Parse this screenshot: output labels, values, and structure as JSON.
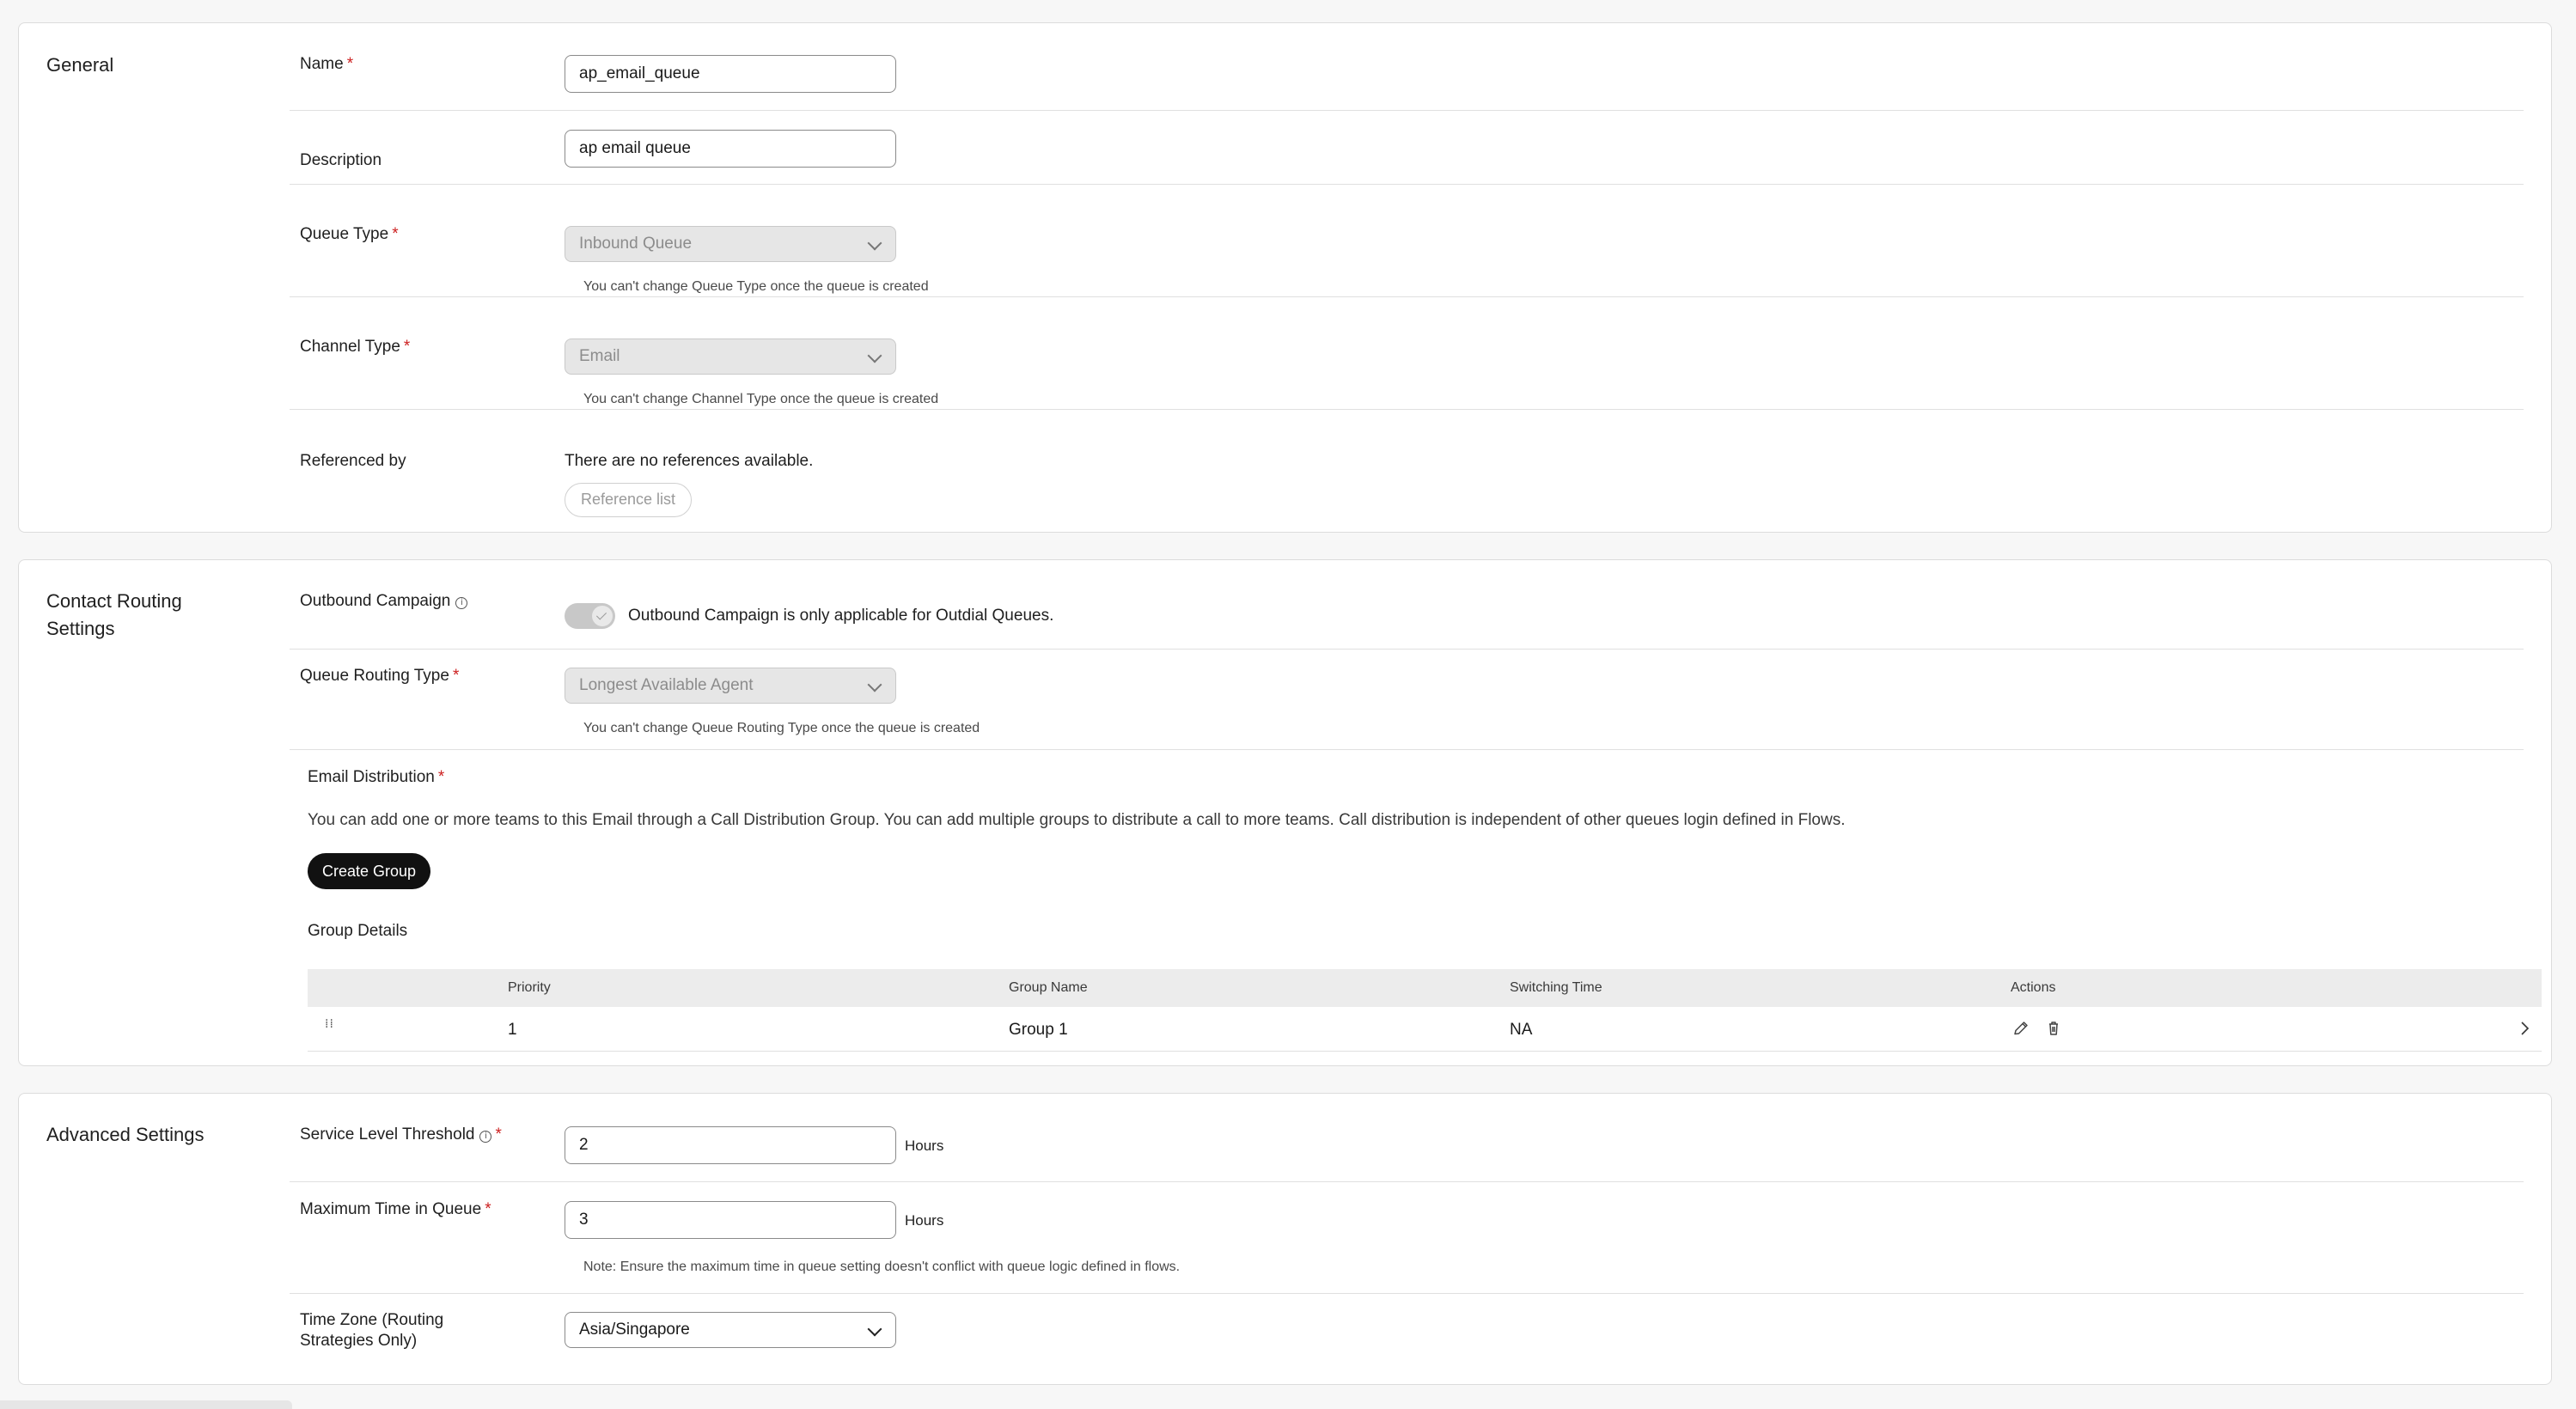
{
  "general": {
    "title": "General",
    "name": {
      "label": "Name",
      "value": "ap_email_queue"
    },
    "description": {
      "label": "Description",
      "value": "ap email queue"
    },
    "queue_type": {
      "label": "Queue Type",
      "value": "Inbound Queue",
      "helper": "You can't change Queue Type once the queue is created"
    },
    "channel_type": {
      "label": "Channel Type",
      "value": "Email",
      "helper": "You can't change Channel Type once the queue is created"
    },
    "referenced_by": {
      "label": "Referenced by",
      "text": "There are no references available.",
      "button": "Reference list"
    }
  },
  "contact_routing": {
    "title": "Contact Routing Settings",
    "outbound_campaign": {
      "label": "Outbound Campaign",
      "text": "Outbound Campaign is only applicable for Outdial Queues."
    },
    "queue_routing_type": {
      "label": "Queue Routing Type",
      "value": "Longest Available Agent",
      "helper": "You can't change Queue Routing Type once the queue is created"
    },
    "email_distribution": {
      "label": "Email Distribution",
      "description": "You can add one or more teams to this Email through a Call Distribution Group. You can add multiple groups to distribute a call to more teams. Call distribution is independent of other queues login defined in Flows.",
      "create_button": "Create Group"
    },
    "group_details": {
      "title": "Group Details",
      "columns": [
        "Priority",
        "Group Name",
        "Switching Time",
        "Actions"
      ],
      "rows": [
        {
          "priority": "1",
          "group_name": "Group 1",
          "switching_time": "NA"
        }
      ]
    }
  },
  "advanced": {
    "title": "Advanced Settings",
    "service_level": {
      "label": "Service Level Threshold",
      "value": "2",
      "unit": "Hours"
    },
    "max_time": {
      "label": "Maximum Time in Queue",
      "value": "3",
      "unit": "Hours",
      "note": "Note: Ensure the maximum time in queue setting doesn't conflict with queue logic defined in flows."
    },
    "time_zone": {
      "label": "Time Zone (Routing Strategies Only)",
      "value": "Asia/Singapore"
    }
  },
  "required_marker": "*",
  "colors": {
    "required": "#cc1f1f",
    "primary_button": "#111111",
    "disabled_field": "#e6e6e6"
  }
}
